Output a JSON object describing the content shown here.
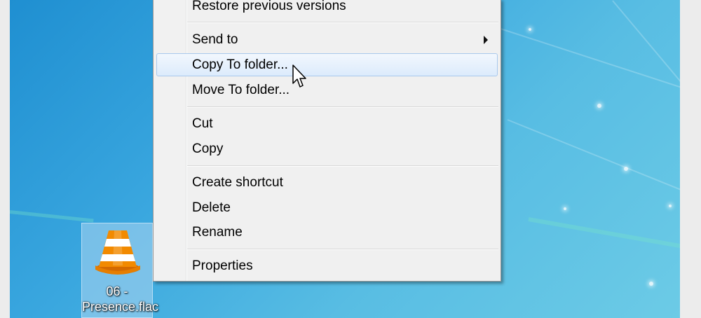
{
  "desktop": {
    "icon": {
      "name": "vlc-cone-icon",
      "label_line1": "06 -",
      "label_line2": "Presence.flac"
    }
  },
  "context_menu": {
    "items": [
      {
        "label": "Restore previous versions"
      },
      {
        "label": "Send to",
        "submenu": true
      },
      {
        "label": "Copy To folder...",
        "highlighted": true
      },
      {
        "label": "Move To folder..."
      },
      {
        "label": "Cut"
      },
      {
        "label": "Copy"
      },
      {
        "label": "Create shortcut"
      },
      {
        "label": "Delete"
      },
      {
        "label": "Rename"
      },
      {
        "label": "Properties"
      }
    ]
  },
  "colors": {
    "highlight_border": "#a8c8ec",
    "menu_background": "#f0f0f0",
    "desktop_blue": "#3aa7df"
  }
}
